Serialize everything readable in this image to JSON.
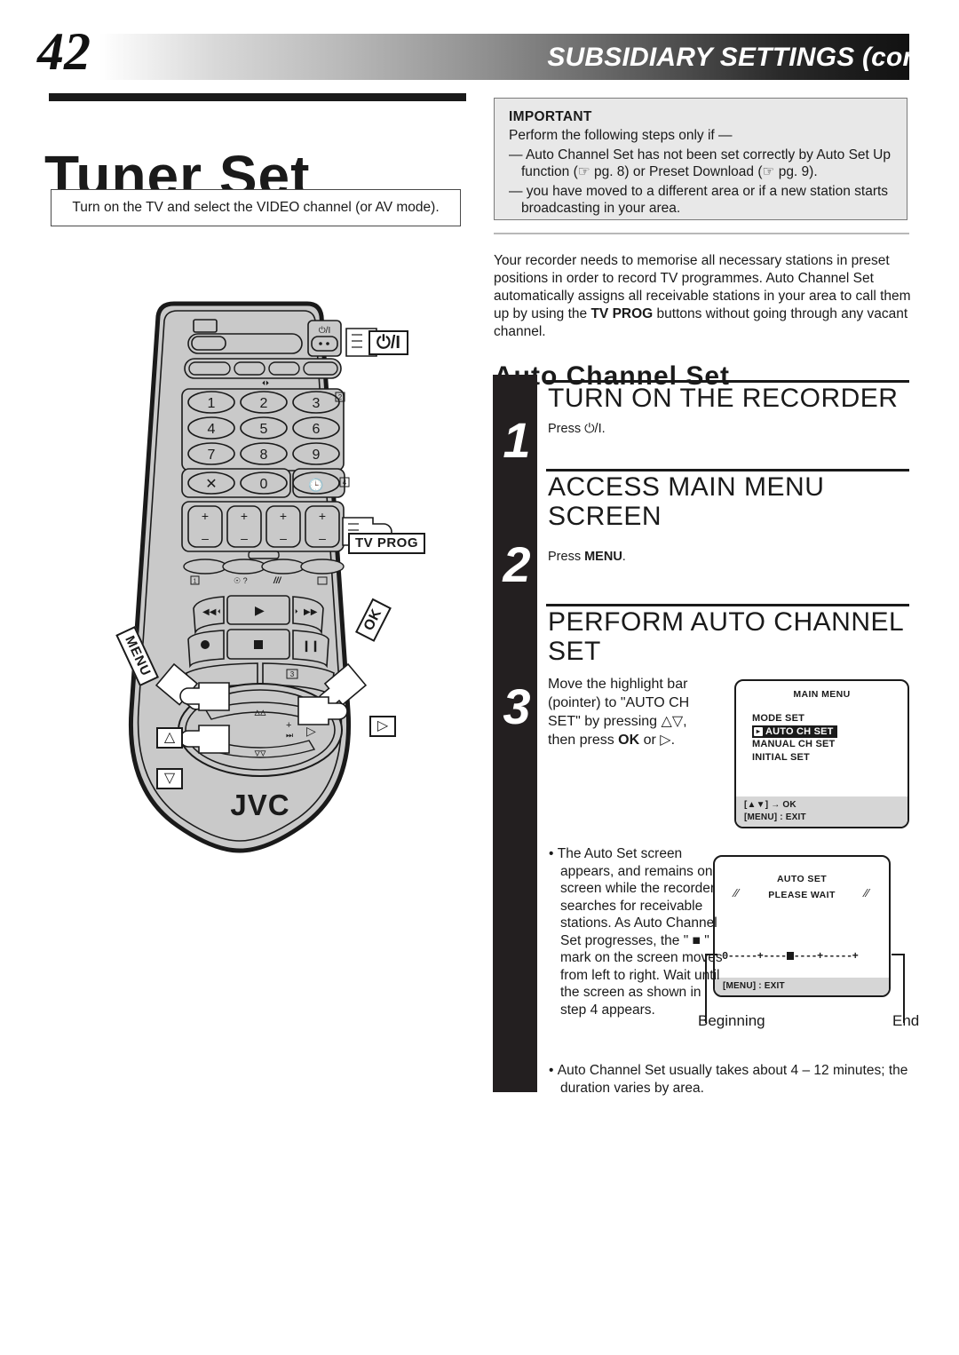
{
  "header": {
    "page_number": "42",
    "title": "SUBSIDIARY SETTINGS (cont.)"
  },
  "left": {
    "page_title": "Tuner Set",
    "tv_note": "Turn on the TV and select the VIDEO channel (or AV mode).",
    "remote": {
      "brand": "JVC",
      "keypad": [
        "1",
        "2",
        "3",
        "4",
        "5",
        "6",
        "7",
        "8",
        "9",
        "X",
        "0",
        "◴"
      ],
      "callouts": [
        {
          "name": "power-callout",
          "label": "⏻/I"
        },
        {
          "name": "tv-prog-callout",
          "label": "TV PROG"
        },
        {
          "name": "menu-callout",
          "label": "MENU"
        },
        {
          "name": "ok-callout",
          "label": "OK"
        },
        {
          "name": "up-callout",
          "label": "△"
        },
        {
          "name": "down-callout",
          "label": "▽"
        },
        {
          "name": "right-callout",
          "label": "▷"
        }
      ],
      "index_marks": [
        "2",
        "4",
        "1",
        "3"
      ],
      "power_label": "⏻/I",
      "plus": "+",
      "minus": "–"
    }
  },
  "right": {
    "important": {
      "heading": "IMPORTANT",
      "lead": "Perform the following steps only if —",
      "items": [
        "— Auto Channel Set has not been set correctly by Auto Set Up function (☞ pg. 8) or Preset Download (☞ pg. 9).",
        "— you have moved to a different area or if a new station starts broadcasting in your area."
      ]
    },
    "intro_html": "Your recorder needs to memorise all necessary stations in preset positions in order to record TV programmes. Auto Channel Set automatically assigns all receivable stations in your area to call them up by using the <b>TV PROG</b> buttons without going through any vacant channel.",
    "section_heading": "Auto Channel Set",
    "steps": [
      {
        "number": "1",
        "heading": "TURN ON THE RECORDER",
        "body_html": "Press ⏻/I."
      },
      {
        "number": "2",
        "heading": "ACCESS MAIN MENU SCREEN",
        "body_html": "Press <b>MENU</b>."
      },
      {
        "number": "3",
        "heading": "PERFORM AUTO CHANNEL SET",
        "body_html": "Move the highlight bar (pointer) to \"AUTO CH SET\" by pressing △▽, then press <b>OK</b> or ▷."
      }
    ],
    "osd_main_menu": {
      "title": "MAIN MENU",
      "items": [
        "MODE SET",
        "AUTO CH SET",
        "MANUAL CH SET",
        "INITIAL SET"
      ],
      "highlighted_item": "AUTO CH SET",
      "footer_line_1": "[▲▼] → OK",
      "footer_line_2": "[MENU] : EXIT"
    },
    "osd_auto_set": {
      "title": "AUTO SET",
      "status": "PLEASE WAIT",
      "progress_start_label": "0",
      "progress_track": "0-----+----■----+-----+",
      "footer": "[MENU] : EXIT",
      "label_beginning": "Beginning",
      "label_end": "End"
    },
    "bullets": [
      "The Auto Set screen appears, and remains on screen while the recorder searches for receivable stations. As Auto Channel Set progresses, the \" ■ \" mark on the screen moves from left to right. Wait until the screen as shown in step 4 appears.",
      "Auto Channel Set usually takes about 4 – 12 minutes; the duration varies by area."
    ]
  },
  "colors": {
    "ink": "#1a1a1a",
    "panel_gray": "#e8e8e8",
    "remote_body": "#c9c9c9",
    "osd_footer": "#d6d6d6"
  }
}
